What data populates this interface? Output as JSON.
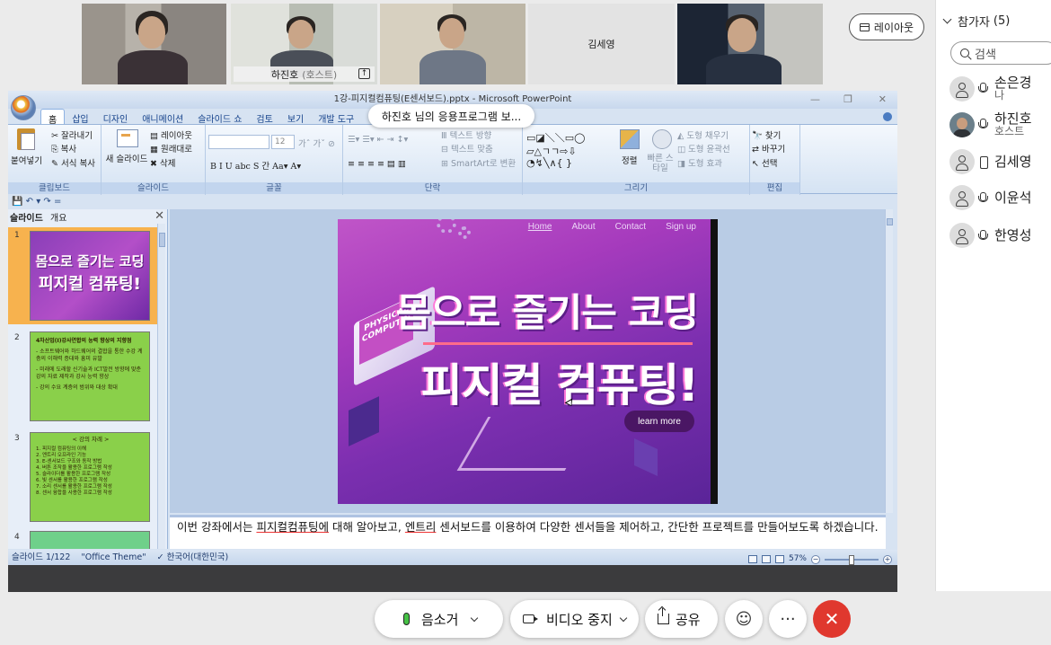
{
  "meeting": {
    "layout_button": "레이아웃",
    "tiles": [
      {
        "name": ""
      },
      {
        "name": "하진호",
        "role": "(호스트)"
      },
      {
        "name": ""
      },
      {
        "name": "김세영"
      },
      {
        "name": ""
      }
    ]
  },
  "participants": {
    "title": "참가자",
    "count": "(5)",
    "search_placeholder": "검색",
    "list": [
      {
        "name": "손은경",
        "sub": "나",
        "device": "mic-icon"
      },
      {
        "name": "하진호",
        "sub": "호스트",
        "device": "mic-icon"
      },
      {
        "name": "김세영",
        "sub": "",
        "device": "phone-icon"
      },
      {
        "name": "이윤석",
        "sub": "",
        "device": "mic-icon"
      },
      {
        "name": "한영성",
        "sub": "",
        "device": "mic-icon"
      }
    ]
  },
  "ppt": {
    "window_title": "1강-피지컬컴퓨팅(E센서보드).pptx - Microsoft PowerPoint",
    "app_notice": "하진호 님의 응용프로그램 보...",
    "tabs": [
      "홈",
      "삽입",
      "디자인",
      "애니메이션",
      "슬라이드 쇼",
      "검토",
      "보기",
      "개발 도구"
    ],
    "ribbon": {
      "clipboard": {
        "label": "클립보드",
        "paste": "붙여넣기",
        "cut": "잘라내기",
        "copy": "복사",
        "format_copy": "서식 복사"
      },
      "slides": {
        "label": "슬라이드",
        "new_slide": "새 슬라이드",
        "layout": "레이아웃",
        "reset": "원래대로",
        "delete": "삭제"
      },
      "font": {
        "label": "글꼴",
        "size": "12"
      },
      "paragraph": {
        "label": "단락",
        "text_direction": "텍스트 방향",
        "text_align": "텍스트 맞춤",
        "smartart": "SmartArt로 변환"
      },
      "drawing": {
        "label": "그리기",
        "arrange": "정렬",
        "quick_styles": "빠른 스타일",
        "fill": "도형 채우기",
        "outline": "도형 윤곽선",
        "effects": "도형 효과"
      },
      "editing": {
        "label": "편집",
        "find": "찾기",
        "replace": "바꾸기",
        "select": "선택"
      }
    },
    "pane_tabs": {
      "slides": "슬라이드",
      "outline": "개요"
    },
    "thumbnails": [
      {
        "num": "1",
        "title1": "몸으로 즐기는 코딩",
        "title2": "피지컬 컴퓨팅!"
      },
      {
        "num": "2",
        "lines": [
          "4차산업(I)강사연합의 능력 향상의 지향점",
          "- 소프트웨어와 하드웨어의 결합을 통한 수강 계층의 이해력 증대와 흥미 유발",
          "- 미래에 도래할 신기술과 ICT발전 방향에 맞춘 강의 자료 제작과 강사 능력 향상",
          "- 강의 수요 계층의 범위와 대상 확대"
        ]
      },
      {
        "num": "3",
        "lines": [
          "< 강의 차례 >",
          "1. 피지컬 컴퓨팅의 이해",
          "2. 엔트리 오프라인 기능",
          "3. E-센서보드 구조와 동작 방법",
          "4. 버튼 조작을 활용한 프로그램 작성",
          "5. 슬라이더를 활용한 프로그램 작성",
          "6. 빛 센서를 활용한 프로그램 작성",
          "7. 소리 센서를 활용한 프로그램 작성",
          "8. 센서 융합을 사용한 프로그램 작성"
        ]
      },
      {
        "num": "4"
      }
    ],
    "slide": {
      "nav": [
        "Home",
        "About",
        "Contact",
        "Sign up"
      ],
      "title1": "몸으로 즐기는 코딩",
      "title2": "피지컬 컴퓨팅!",
      "laptop_text": "PHYSICAL COMPUTIN",
      "button": "learn more"
    },
    "notes": {
      "t1": "이번 강좌에서는 ",
      "u1": "피지컬컴퓨팅에",
      "t2": " 대해 알아보고, ",
      "u2": "엔트리",
      "t3": " 센서보드를 이용하여 다양한 센서들을 제어하고, 간단한 프로젝트를 만들어보도록 하겠습니다."
    },
    "status": {
      "slide": "슬라이드 1/122",
      "theme": "\"Office Theme\"",
      "language": "한국어(대한민국)",
      "zoom": "57%"
    }
  },
  "controls": {
    "mute": "음소거",
    "video": "비디오 중지",
    "share": "공유",
    "reaction_icon": "smiley-icon",
    "more": "···",
    "end": "✕"
  }
}
